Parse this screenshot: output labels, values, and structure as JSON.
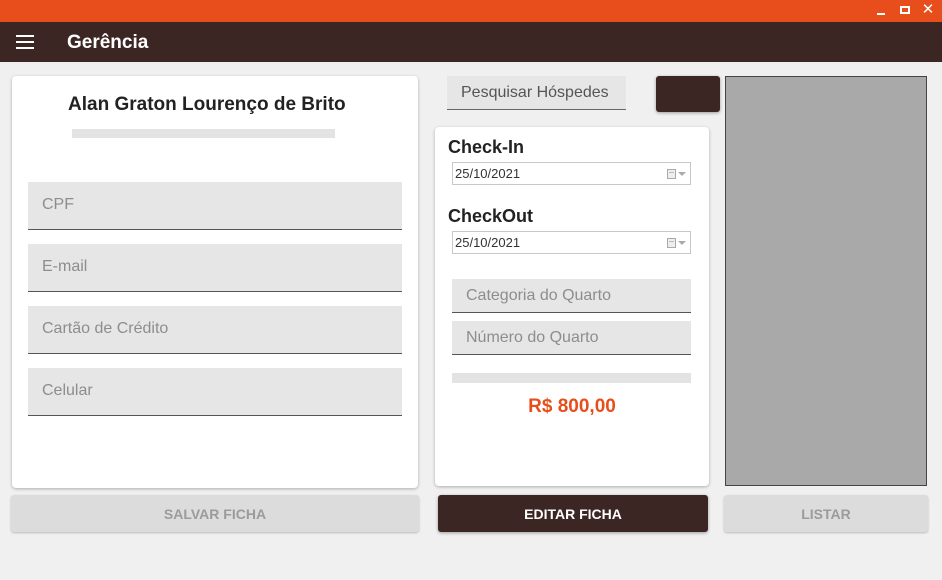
{
  "colors": {
    "titlebar": "#e84e1b",
    "appbar": "#3c2623",
    "accent": "#e84e1b",
    "primary_button": "#3c2623",
    "list_panel": "#a9a9a9"
  },
  "titlebar": {
    "minimize_icon": "minimize-icon",
    "maximize_icon": "maximize-icon",
    "close_icon": "close-icon",
    "close_glyph": "✕"
  },
  "appbar": {
    "menu_icon": "hamburger-menu-icon",
    "title": "Gerência"
  },
  "guest": {
    "name": "Alan Graton Lourenço de Brito",
    "fields": [
      {
        "placeholder": "CPF",
        "value": ""
      },
      {
        "placeholder": "E-mail",
        "value": ""
      },
      {
        "placeholder": "Cartão de Crédito",
        "value": ""
      },
      {
        "placeholder": "Celular",
        "value": ""
      }
    ]
  },
  "search": {
    "placeholder": "Pesquisar Hóspedes",
    "button_label": ""
  },
  "booking": {
    "checkin_label": "Check-In",
    "checkin_date": "25/10/2021",
    "checkout_label": "CheckOut",
    "checkout_date": "25/10/2021",
    "room_category_placeholder": "Categoria do Quarto",
    "room_number_placeholder": "Número do Quarto",
    "price": "R$ 800,00"
  },
  "actions": {
    "save_label": "SALVAR FICHA",
    "edit_label": "EDITAR FICHA",
    "list_label": "LISTAR"
  }
}
